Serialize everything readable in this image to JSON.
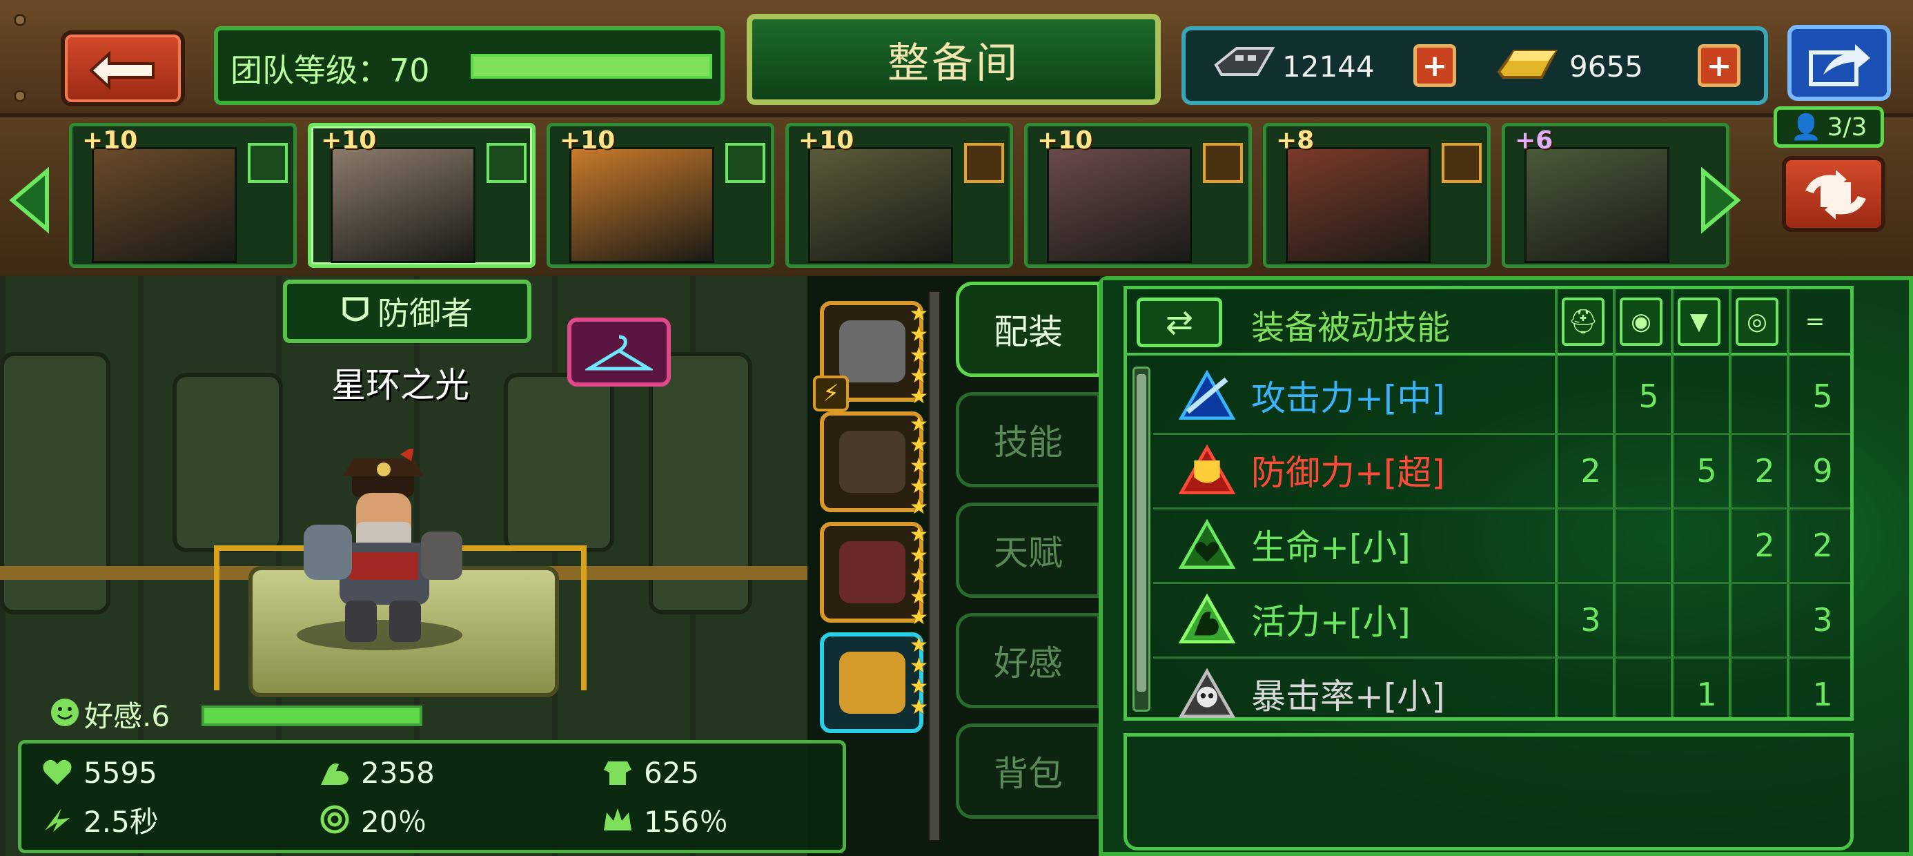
{
  "header": {
    "team_level_label": "团队等级：70",
    "team_level_progress": 1.0,
    "title": "整备间"
  },
  "currency": [
    {
      "icon": "gear-chip-icon",
      "value": "12144"
    },
    {
      "icon": "gold-bar-icon",
      "value": "9655"
    }
  ],
  "heroes": [
    {
      "level": "+10",
      "tag": "green",
      "selected": false
    },
    {
      "level": "+10",
      "tag": "green",
      "selected": true
    },
    {
      "level": "+10",
      "tag": "green",
      "selected": false
    },
    {
      "level": "+10",
      "tag": "orange",
      "selected": false
    },
    {
      "level": "+10",
      "tag": "orange",
      "selected": false
    },
    {
      "level": "+8",
      "tag": "orange",
      "selected": false
    },
    {
      "level": "+6",
      "tag": "none",
      "selected": false
    }
  ],
  "team_count": "3/3",
  "character": {
    "class_label": "防御者",
    "name": "星环之光",
    "favor_label": "好感.6",
    "favor_progress": 1.0
  },
  "stats": {
    "hp": "5595",
    "attack": "2358",
    "defense": "625",
    "interval": "2.5秒",
    "crit": "20％",
    "crit_damage": "156％"
  },
  "equipment": [
    {
      "icon": "helmet-icon",
      "stars": 5,
      "frame": "gold",
      "badge": "⚡"
    },
    {
      "icon": "armor-icon",
      "stars": 5,
      "frame": "gold"
    },
    {
      "icon": "mask-icon",
      "stars": 5,
      "frame": "gold"
    },
    {
      "icon": "chest-icon",
      "stars": 4,
      "frame": "blue"
    }
  ],
  "tabs": [
    {
      "label": "配装",
      "active": true
    },
    {
      "label": "技能",
      "active": false
    },
    {
      "label": "天赋",
      "active": false
    },
    {
      "label": "好感",
      "active": false
    },
    {
      "label": "背包",
      "active": false
    }
  ],
  "skill_panel": {
    "title": "装备被动技能",
    "total_symbol": "=",
    "rows": [
      {
        "name": "攻击力+[中]",
        "color": "#3ab4ff",
        "icon": "attack-icon",
        "values": [
          "",
          "5",
          "",
          "",
          "5"
        ]
      },
      {
        "name": "防御力+[超]",
        "color": "#ff4a3a",
        "icon": "defense-icon",
        "values": [
          "2",
          "",
          "5",
          "2",
          "9"
        ]
      },
      {
        "name": "生命+[小]",
        "color": "#6be860",
        "icon": "life-icon",
        "values": [
          "",
          "",
          "",
          "2",
          "2"
        ]
      },
      {
        "name": "活力+[小]",
        "color": "#6be860",
        "icon": "vitality-icon",
        "values": [
          "3",
          "",
          "",
          "",
          "3"
        ]
      },
      {
        "name": "暴击率+[小]",
        "color": "#d8d8d8",
        "icon": "crit-skull-icon",
        "values": [
          "",
          "",
          "1",
          "",
          "1"
        ]
      }
    ]
  }
}
